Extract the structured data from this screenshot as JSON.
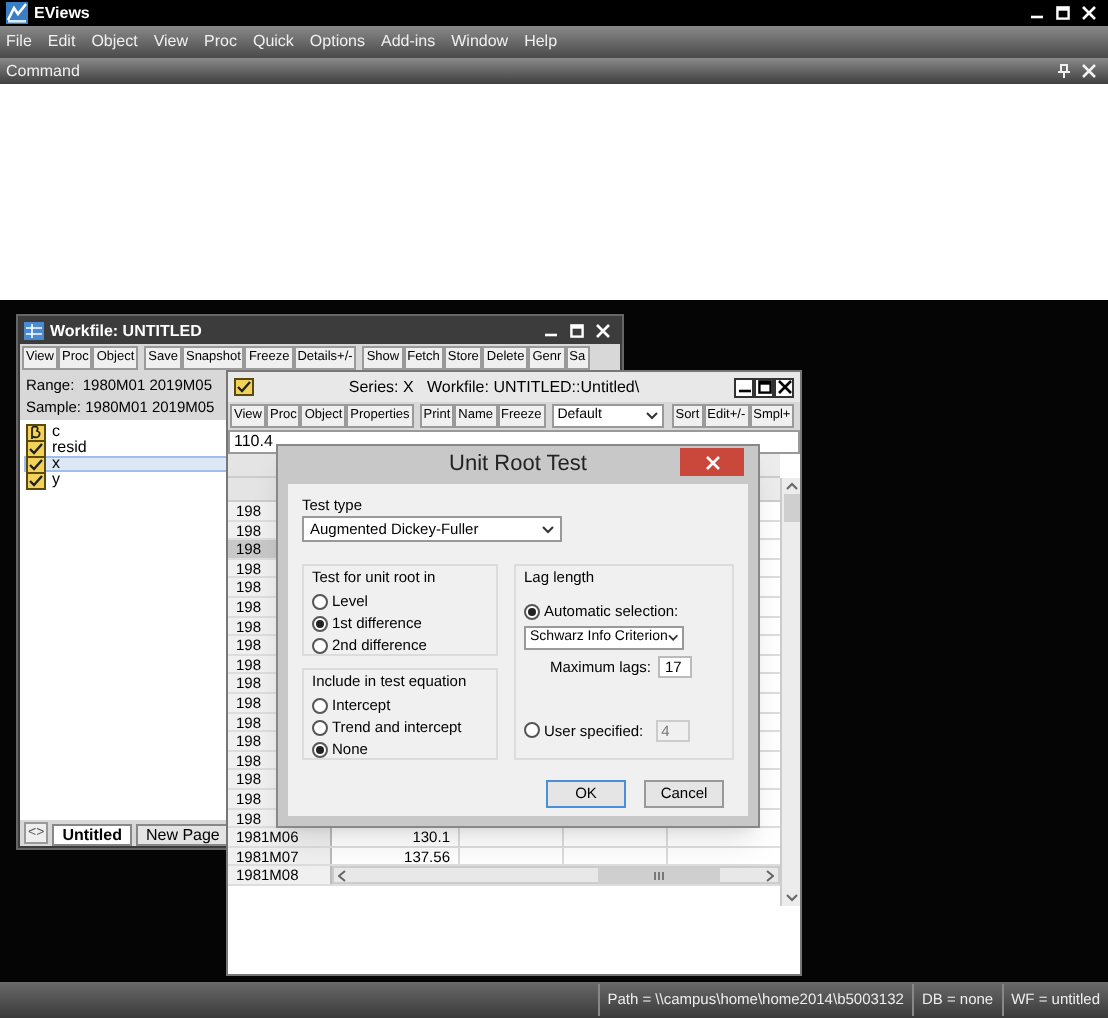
{
  "app": {
    "title": "EViews"
  },
  "menu": [
    "File",
    "Edit",
    "Object",
    "View",
    "Proc",
    "Quick",
    "Options",
    "Add-ins",
    "Window",
    "Help"
  ],
  "command_bar": {
    "title": "Command"
  },
  "workfile_window": {
    "title": "Workfile: UNTITLED",
    "toolbar": [
      [
        "View",
        "Proc",
        "Object"
      ],
      [
        "Save",
        "Snapshot",
        "Freeze",
        "Details+/-"
      ],
      [
        "Show",
        "Fetch",
        "Store",
        "Delete",
        "Genr",
        "Sa"
      ]
    ],
    "range": "Range:  1980M01 2019M05",
    "sample": "Sample: 1980M01 2019M05",
    "objects": [
      {
        "name": "c",
        "kind": "coef",
        "selected": false
      },
      {
        "name": "resid",
        "kind": "series",
        "selected": false
      },
      {
        "name": "x",
        "kind": "series",
        "selected": true
      },
      {
        "name": "y",
        "kind": "series",
        "selected": false
      }
    ],
    "page_nav": "<>",
    "tabs": [
      {
        "label": "Untitled",
        "selected": true
      },
      {
        "label": "New Page",
        "selected": false
      }
    ]
  },
  "series_window": {
    "title": "Series: X   Workfile: UNTITLED::Untitled\\",
    "toolbar": [
      [
        "View",
        "Proc",
        "Object",
        "Properties"
      ],
      [
        "Print",
        "Name",
        "Freeze"
      ]
    ],
    "view_select": "Default",
    "toolbar_right": [
      "Sort",
      "Edit+/-",
      "Smpl+"
    ],
    "value": "110.4",
    "rows": [
      {
        "label": "198",
        "selected": false
      },
      {
        "label": "198",
        "selected": false
      },
      {
        "label": "198",
        "selected": true
      },
      {
        "label": "198",
        "selected": false
      },
      {
        "label": "198",
        "selected": false
      },
      {
        "label": "198",
        "selected": false
      },
      {
        "label": "198",
        "selected": false
      },
      {
        "label": "198",
        "selected": false
      },
      {
        "label": "198",
        "selected": false
      },
      {
        "label": "198",
        "selected": false
      },
      {
        "label": "198",
        "selected": false
      },
      {
        "label": "198",
        "selected": false
      },
      {
        "label": "198",
        "selected": false
      },
      {
        "label": "198",
        "selected": false
      },
      {
        "label": "198",
        "selected": false
      },
      {
        "label": "198",
        "selected": false
      },
      {
        "label": "198",
        "selected": false
      },
      {
        "label": "1981M06",
        "value": "130.1",
        "selected": false
      },
      {
        "label": "1981M07",
        "value": "137.56",
        "selected": false
      },
      {
        "label": "1981M08",
        "selected": false
      }
    ]
  },
  "dialog": {
    "title": "Unit Root Test",
    "test_type_label": "Test type",
    "test_type": "Augmented Dickey-Fuller",
    "unit_root_in": {
      "title": "Test for unit root in",
      "options": [
        {
          "label": "Level",
          "selected": false
        },
        {
          "label": "1st difference",
          "selected": true
        },
        {
          "label": "2nd difference",
          "selected": false
        }
      ]
    },
    "include": {
      "title": "Include in test equation",
      "options": [
        {
          "label": "Intercept",
          "selected": false
        },
        {
          "label": "Trend and intercept",
          "selected": false
        },
        {
          "label": "None",
          "selected": true
        }
      ]
    },
    "lag_length": {
      "title": "Lag length",
      "auto": {
        "label": "Automatic selection:",
        "selected": true,
        "criterion": "Schwarz Info Criterion",
        "max_lags_label": "Maximum lags:",
        "max_lags": "17"
      },
      "user": {
        "label": "User specified:",
        "selected": false,
        "value": "4"
      }
    },
    "buttons": [
      "OK",
      "Cancel"
    ]
  },
  "status_bar": [
    "Path = \\\\campus\\home\\home2014\\b5003132",
    "DB = none",
    "WF = untitled"
  ]
}
